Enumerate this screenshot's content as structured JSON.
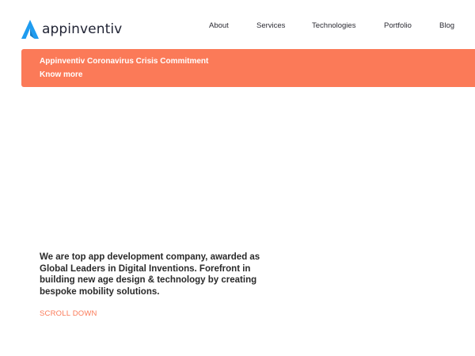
{
  "brand": {
    "name": "appinventiv",
    "logo_icon": "a-chevron-logo-icon",
    "logo_color": "#1f9cf0",
    "text_color": "#1f2233"
  },
  "nav": {
    "items": [
      {
        "label": "About"
      },
      {
        "label": "Services"
      },
      {
        "label": "Technologies"
      },
      {
        "label": "Portfolio"
      },
      {
        "label": "Blog"
      }
    ]
  },
  "banner": {
    "title": "Appinventiv Coronavirus Crisis Commitment",
    "link_label": "Know more",
    "background": "#fb7a58"
  },
  "hero": {
    "description": "We are top app development company, awarded as Global Leaders in Digital Inventions. Forefront in building new age design & technology by creating bespoke mobility solutions.",
    "scroll_label": "SCROLL DOWN",
    "accent": "#fb7a58"
  }
}
